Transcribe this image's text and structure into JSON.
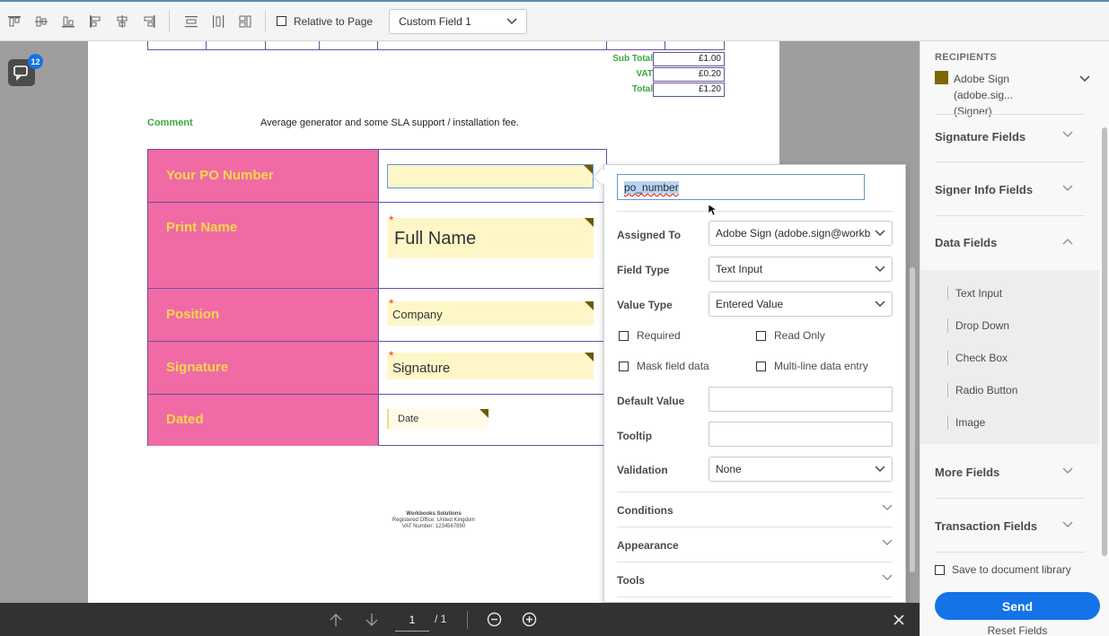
{
  "toolbar": {
    "icons": [
      "align-top-icon",
      "center-vertical-icon",
      "align-bottom-icon",
      "align-left-icon",
      "center-horizontal-icon",
      "align-right-icon",
      "distribute-vertical-icon",
      "distribute-horizontal-icon",
      "match-size-icon"
    ],
    "relative_to_page": "Relative to Page",
    "field_select": "Custom Field 1"
  },
  "comments": {
    "count": "12"
  },
  "document": {
    "totals": [
      {
        "label": "Sub Total",
        "value": "£1.00"
      },
      {
        "label": "VAT",
        "value": "£0.20"
      },
      {
        "label": "Total",
        "value": "£1.20"
      }
    ],
    "comment_label": "Comment",
    "comment_text": "Average generator and some SLA support / installation fee.",
    "rows": [
      {
        "label": "Your PO Number"
      },
      {
        "label": "Print Name",
        "field": "Full Name"
      },
      {
        "label": "Position",
        "field": "Company"
      },
      {
        "label": "Signature",
        "field": "Signature"
      },
      {
        "label": "Dated",
        "field": "Date"
      }
    ],
    "footer": [
      "Workbooks Solutions",
      "Registered Office: United Kingdom",
      "VAT Number: 1234567890"
    ]
  },
  "popover": {
    "field_name": "po_number",
    "assigned_to_label": "Assigned To",
    "assigned_to_value": "Adobe Sign (adobe.sign@workb",
    "field_type_label": "Field Type",
    "field_type_value": "Text Input",
    "value_type_label": "Value Type",
    "value_type_value": "Entered Value",
    "required": "Required",
    "read_only": "Read Only",
    "mask": "Mask field data",
    "multiline": "Multi-line data entry",
    "default_value_label": "Default Value",
    "tooltip_label": "Tooltip",
    "validation_label": "Validation",
    "validation_value": "None",
    "conditions": "Conditions",
    "appearance": "Appearance",
    "tools": "Tools"
  },
  "right_panel": {
    "header": "RECIPIENTS",
    "recipient_line1": "Adobe Sign (adobe.sig...",
    "recipient_line2": "(Signer)",
    "recipient_color": "#7d6608",
    "sections": [
      "Signature Fields",
      "Signer Info Fields",
      "Data Fields",
      "More Fields",
      "Transaction Fields"
    ],
    "data_fields": [
      "Text Input",
      "Drop Down",
      "Check Box",
      "Radio Button",
      "Image"
    ],
    "save_library": "Save to document library",
    "send": "Send",
    "reset": "Reset Fields"
  },
  "bottom_bar": {
    "page_current": "1",
    "page_total": "/ 1"
  }
}
